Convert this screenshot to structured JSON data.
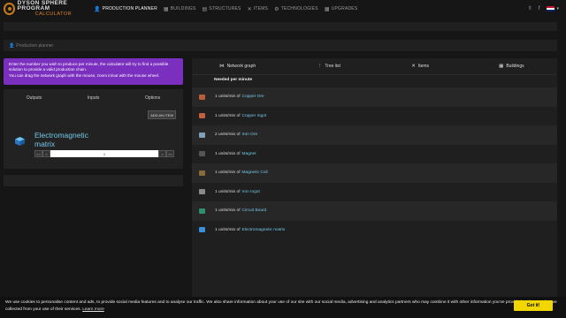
{
  "header": {
    "logo_line1": "DYSON SPHERE PROGRAM",
    "logo_line2": "CALCULATOR",
    "nav": [
      {
        "label": "PRODUCTION PLANNER",
        "icon": "user-icon",
        "glyph": "👤",
        "active": true
      },
      {
        "label": "BUILDINGS",
        "icon": "building-icon",
        "glyph": "▦"
      },
      {
        "label": "STRUCTURES",
        "icon": "structures-icon",
        "glyph": "▤"
      },
      {
        "label": "ITEMS",
        "icon": "tools-icon",
        "glyph": "✕"
      },
      {
        "label": "TECHNOLOGIES",
        "icon": "technologies-icon",
        "glyph": "⚙"
      },
      {
        "label": "UPGRADES",
        "icon": "upgrades-icon",
        "glyph": "▦"
      }
    ],
    "right_icons": [
      "twitter-icon",
      "facebook-icon",
      "flag-uk-icon"
    ]
  },
  "breadcrumb": {
    "label": "Production planner"
  },
  "info_text_1": "Enter the number you wish to produce per minute, the calculator will try to find a possible solution to provide a valid production chain.",
  "info_text_2": "You can drag the network graph with the mouse, zoom in/out with the mouse wheel.",
  "left_panel": {
    "tabs": [
      "Outputs",
      "Inputs",
      "Options"
    ],
    "add_button": "ADD AN ITEM",
    "item_name": "Electromagnetic matrix",
    "quantity": "1",
    "minus_labels": [
      "<<",
      "<"
    ],
    "plus_labels": [
      ">",
      ">>"
    ]
  },
  "right_panel": {
    "tabs": [
      {
        "label": "Network graph",
        "glyph": "⋈"
      },
      {
        "label": "Tree list",
        "glyph": "⋮"
      },
      {
        "label": "Items",
        "glyph": "✕"
      },
      {
        "label": "Buildings",
        "glyph": "▦"
      }
    ],
    "needed_heading": "Needed per minute",
    "rows": [
      {
        "prefix": "1 units/min of",
        "name": "Copper Ore",
        "icon": "copper-ore-icon",
        "color": "#b85c3a"
      },
      {
        "prefix": "1 units/min of",
        "name": "Copper Ingot",
        "icon": "copper-ingot-icon",
        "color": "#c0603f"
      },
      {
        "prefix": "2 units/min of",
        "name": "Iron Ore",
        "icon": "iron-ore-icon",
        "color": "#7fa0b8"
      },
      {
        "prefix": "1 units/min of",
        "name": "Magnet",
        "icon": "magnet-icon",
        "color": "#555555"
      },
      {
        "prefix": "1 units/min of",
        "name": "Magnetic Coil",
        "icon": "magnetic-coil-icon",
        "color": "#8a6a3a"
      },
      {
        "prefix": "1 units/min of",
        "name": "Iron Ingot",
        "icon": "iron-ingot-icon",
        "color": "#8a8a8a"
      },
      {
        "prefix": "1 units/min of",
        "name": "Circuit Board",
        "icon": "circuit-board-icon",
        "color": "#2f8f6a"
      },
      {
        "prefix": "1 units/min of",
        "name": "Electromagnetic matrix",
        "icon": "electromagnetic-matrix-icon",
        "color": "#3a8fd8"
      }
    ]
  },
  "cookie": {
    "text": "We use cookies to personalise content and ads, to provide social media features and to analyse our traffic. We also share information about your use of our site with our social media, advertising and analytics partners who may combine it with other information you've provided to them or they've collected from your use of their services.",
    "learn_more": "Learn more",
    "button": "Got it!",
    "button_color": "#f1d600"
  }
}
